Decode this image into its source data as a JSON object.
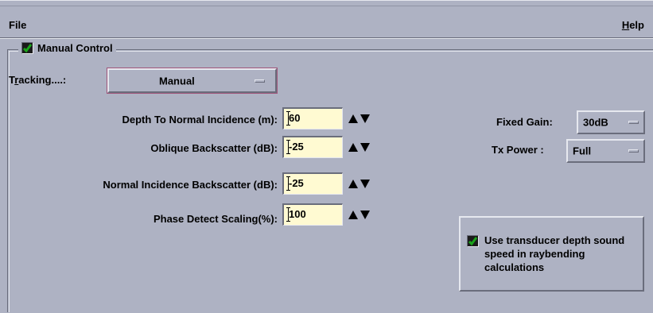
{
  "menubar": {
    "file": "File",
    "help": "Help"
  },
  "manual_control": {
    "label": "Manual Control",
    "checked": true
  },
  "tracking": {
    "label_prefix": "T",
    "label_mnemonic": "r",
    "label_suffix": "acking....:",
    "value": "Manual"
  },
  "fields": [
    {
      "label": "Depth To Normal Incidence (m):",
      "value": "60"
    },
    {
      "label": "Oblique Backscatter (dB):",
      "value": "-25"
    },
    {
      "label": "Normal Incidence Backscatter (dB):",
      "value": "-25"
    },
    {
      "label": "Phase Detect Scaling(%):",
      "value": "100"
    }
  ],
  "fixed_gain": {
    "label": "Fixed Gain:",
    "value": "30dB"
  },
  "tx_power": {
    "label": "Tx Power :",
    "value": "Full"
  },
  "transducer": {
    "text": "Use transducer depth sound speed in raybending calculations",
    "checked": true
  },
  "colors": {
    "background": "#aeb2c3",
    "input_bg": "#fffad2",
    "check_green": "#1aa51a"
  }
}
